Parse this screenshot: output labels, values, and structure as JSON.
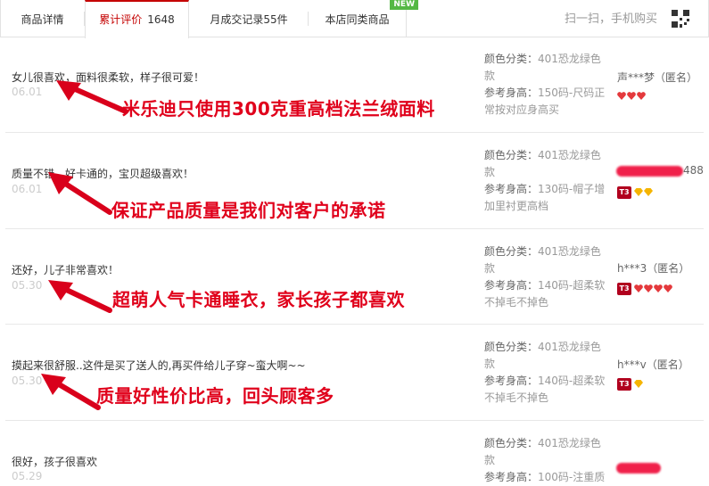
{
  "tabs": {
    "items": [
      {
        "label": "商品详情",
        "count": ""
      },
      {
        "label": "累计评价",
        "count": "1648"
      },
      {
        "label": "月成交记录55件",
        "count": ""
      },
      {
        "label": "本店同类商品",
        "count": ""
      }
    ],
    "new_badge": "NEW",
    "scan_text": "扫一扫，手机购买"
  },
  "labels": {
    "color_label": "颜色分类：",
    "height_label": "参考身高："
  },
  "reviews": [
    {
      "comment": "女儿很喜欢，面料很柔软，样子很可爱！",
      "date": "06.01",
      "promo": "米乐迪只使用300克重高档法兰绒面料",
      "color_value": "401恐龙绿色款",
      "height_value": "150码-尺码正常按对应身高买",
      "user": "声***梦（匿名）",
      "badges": [
        "heart",
        "heart",
        "heart"
      ],
      "t3": ""
    },
    {
      "comment": "质量不错、好卡通的，宝贝超级喜欢！",
      "date": "06.01",
      "promo": "保证产品质量是我们对客户的承诺",
      "color_value": "401恐龙绿色款",
      "height_value": "130码-帽子增加里衬更高档",
      "user": "488",
      "badges": [
        "diamond",
        "diamond"
      ],
      "t3": "T3"
    },
    {
      "comment": "还好，儿子非常喜欢！",
      "date": "05.30",
      "promo": "超萌人气卡通睡衣，家长孩子都喜欢",
      "color_value": "401恐龙绿色款",
      "height_value": "140码-超柔软不掉毛不掉色",
      "user": "h***3（匿名）",
      "badges": [
        "heart",
        "heart",
        "heart",
        "heart"
      ],
      "t3": "T3"
    },
    {
      "comment": "摸起来很舒服..这件是买了送人的,再买件给儿子穿~蛮大啊~~",
      "date": "05.30",
      "promo": "质量好性价比高，回头顾客多",
      "color_value": "401恐龙绿色款",
      "height_value": "140码-超柔软不掉毛不掉色",
      "user": "h***v（匿名）",
      "badges": [
        "diamond"
      ],
      "t3": "T3"
    },
    {
      "comment": "很好，孩子很喜欢",
      "date": "05.29",
      "promo": "",
      "color_value": "401恐龙绿色款",
      "height_value": "100码-注重质",
      "user": "",
      "badges": [],
      "t3": ""
    }
  ],
  "colors": {
    "accent": "#c40000",
    "promo": "#e0001b",
    "arrow": "#d9001b",
    "heart": "#e4393c",
    "diamond": "#f5b400",
    "new_badge": "#54b844"
  }
}
